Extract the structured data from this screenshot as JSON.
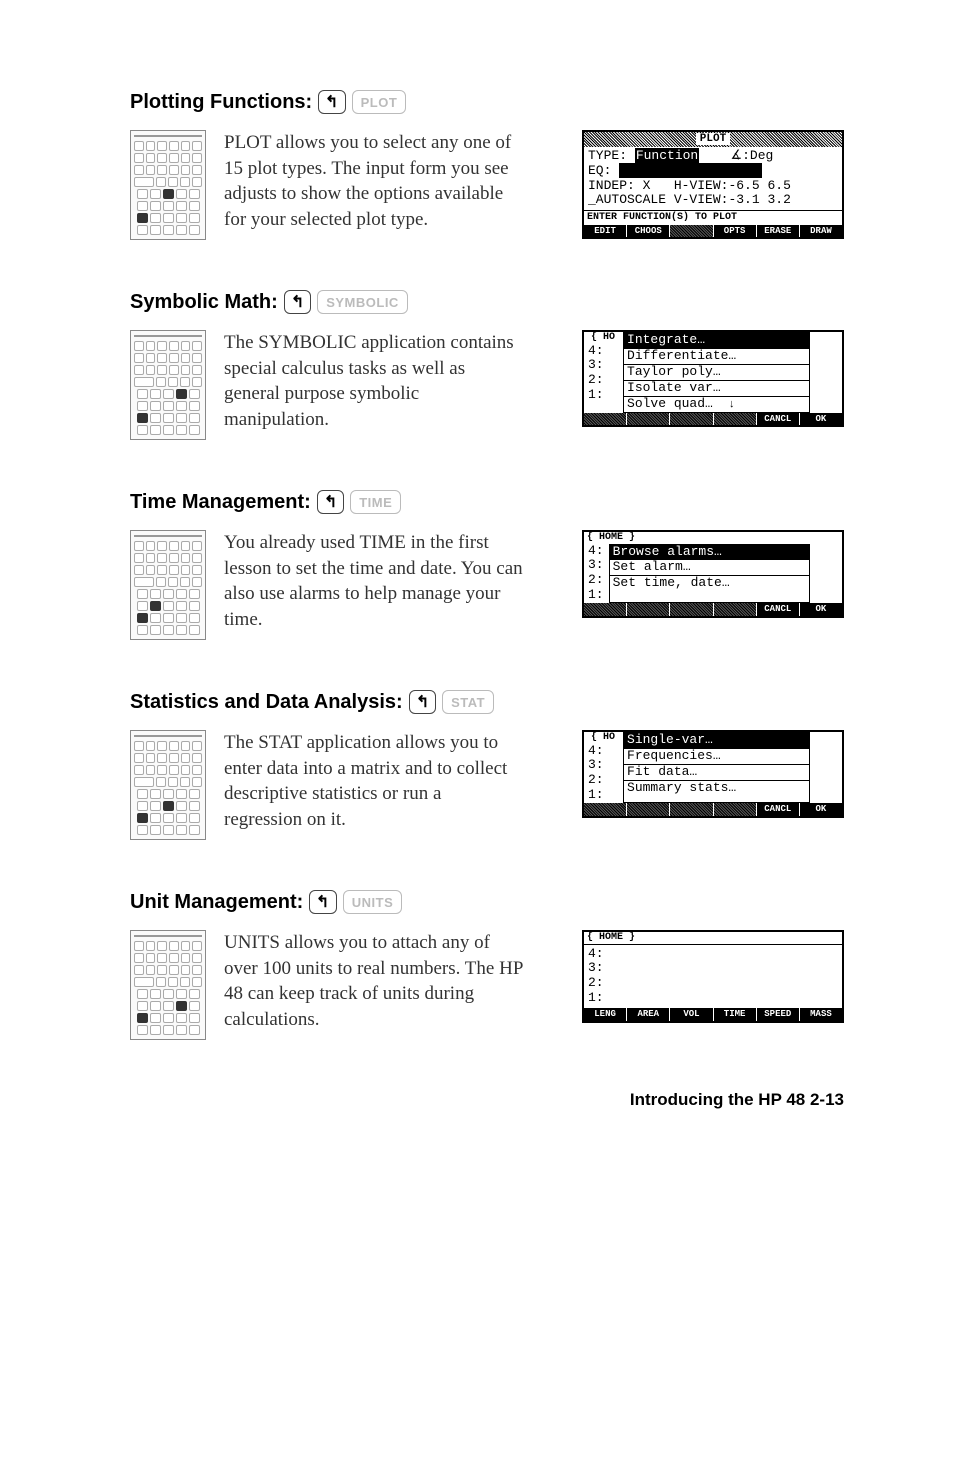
{
  "sections": [
    {
      "title": "Plotting Functions:",
      "keylabel": "PLOT",
      "body": "PLOT allows you to select any one of 15 plot types. The input form you see adjusts to show the options available for your selected plot type.",
      "plot": {
        "title": "PLOT",
        "type_label": "TYPE:",
        "type_value": "Function",
        "angle": "∡:Deg",
        "eq_label": "EQ:",
        "indep_label": "INDEP:",
        "indep_value": "X",
        "hview_label": "H-VIEW:",
        "hview_lo": "-6.5",
        "hview_hi": "6.5",
        "autoscale": "_AUTOSCALE",
        "vview_label": "V-VIEW:",
        "vview_lo": "-3.1",
        "vview_hi": "3.2",
        "status": "ENTER FUNCTION(S) TO PLOT",
        "softkeys": [
          "EDIT",
          "CHOOS",
          "",
          "OPTS",
          "ERASE",
          "DRAW"
        ]
      }
    },
    {
      "title": "Symbolic Math:",
      "keylabel": "SYMBOLIC",
      "body": "The SYMBOLIC application contains special calculus tasks as well as general purpose symbolic manipulation.",
      "menu": {
        "header": "{ HO",
        "items": [
          "Integrate…",
          "Differentiate…",
          "Taylor poly…",
          "Isolate var…",
          "Solve quad…"
        ],
        "selected": 0,
        "nums": [
          "4:",
          "3:",
          "2:",
          "1:"
        ],
        "scroll": "↓",
        "softkeys": [
          "",
          "",
          "",
          "",
          "CANCL",
          "OK"
        ]
      }
    },
    {
      "title": "Time Management:",
      "keylabel": "TIME",
      "body": "You already used TIME in the first lesson to set the time and date. You can also use alarms to help manage your time.",
      "menu": {
        "header": "{ HOME }",
        "items": [
          "Browse alarms…",
          "Set alarm…",
          "Set time, date…"
        ],
        "selected": 0,
        "nums": [
          "4:",
          "3:",
          "2:",
          "1:"
        ],
        "softkeys": [
          "",
          "",
          "",
          "",
          "CANCL",
          "OK"
        ]
      }
    },
    {
      "title": "Statistics and Data Analysis:",
      "keylabel": "STAT",
      "body": "The STAT application allows you to enter data into a matrix and to collect descriptive statistics or run a regression on it.",
      "menu": {
        "header": "{ HO",
        "items": [
          "Single-var…",
          "Frequencies…",
          "Fit data…",
          "Summary stats…"
        ],
        "selected": 0,
        "nums": [
          "4:",
          "3:",
          "2:",
          "1:"
        ],
        "softkeys": [
          "",
          "",
          "",
          "",
          "CANCL",
          "OK"
        ]
      }
    },
    {
      "title": "Unit Management:",
      "keylabel": "UNITS",
      "body": "UNITS allows you to attach any of over 100 units to real numbers. The HP 48 can keep track of units during calculations.",
      "stack": {
        "header": "{ HOME }",
        "nums": [
          "4:",
          "3:",
          "2:",
          "1:"
        ],
        "softkeys": [
          "LENG",
          "AREA",
          "VOL",
          "TIME",
          "SPEED",
          "MASS"
        ]
      }
    }
  ],
  "footer": "Introducing the HP 48   2-13"
}
